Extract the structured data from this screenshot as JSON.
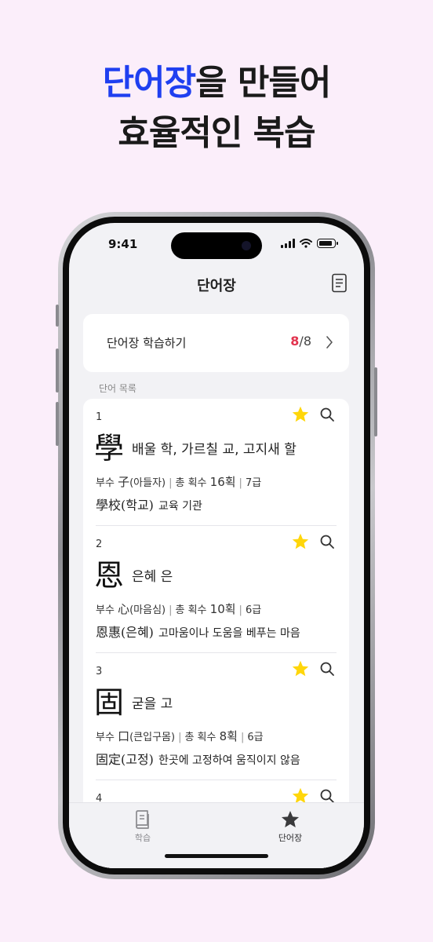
{
  "headline": {
    "line1_accent": "단어장",
    "line1_rest": "을 만들어",
    "line2": "효율적인 복습"
  },
  "status": {
    "time": "9:41"
  },
  "nav": {
    "title": "단어장",
    "icon": "document-icon"
  },
  "study": {
    "label": "단어장 학습하기",
    "done": "8",
    "total": "/8"
  },
  "section_label": "단어 목록",
  "entries": [
    {
      "num": "1",
      "hanja": "學",
      "meaning": "배울 학, 가르칠 교, 고지새 할",
      "radical_prefix": "부수",
      "radical": "子",
      "radical_name": "(아들자)",
      "strokes_label": "총 획수",
      "strokes": "16획",
      "grade": "7급",
      "example_word": "學校(학교)",
      "example_meaning": "교육 기관"
    },
    {
      "num": "2",
      "hanja": "恩",
      "meaning": "은혜 은",
      "radical_prefix": "부수",
      "radical": "心",
      "radical_name": "(마음심)",
      "strokes_label": "총 획수",
      "strokes": "10획",
      "grade": "6급",
      "example_word": "恩惠(은혜)",
      "example_meaning": "고마움이나 도움을 베푸는 마음"
    },
    {
      "num": "3",
      "hanja": "固",
      "meaning": "굳을 고",
      "radical_prefix": "부수",
      "radical": "口",
      "radical_name": "(큰입구몸)",
      "strokes_label": "총 획수",
      "strokes": "8획",
      "grade": "6급",
      "example_word": "固定(고정)",
      "example_meaning": "한곳에 고정하여 움직이지 않음"
    },
    {
      "num": "4"
    }
  ],
  "tabs": [
    {
      "label": "학습",
      "icon": "book-icon",
      "active": false
    },
    {
      "label": "단어장",
      "icon": "star-icon",
      "active": true
    }
  ],
  "colors": {
    "accent": "#1f3ff0",
    "count_done": "#e2334e",
    "star": "#ffd60a",
    "background": "#fbeefa"
  }
}
